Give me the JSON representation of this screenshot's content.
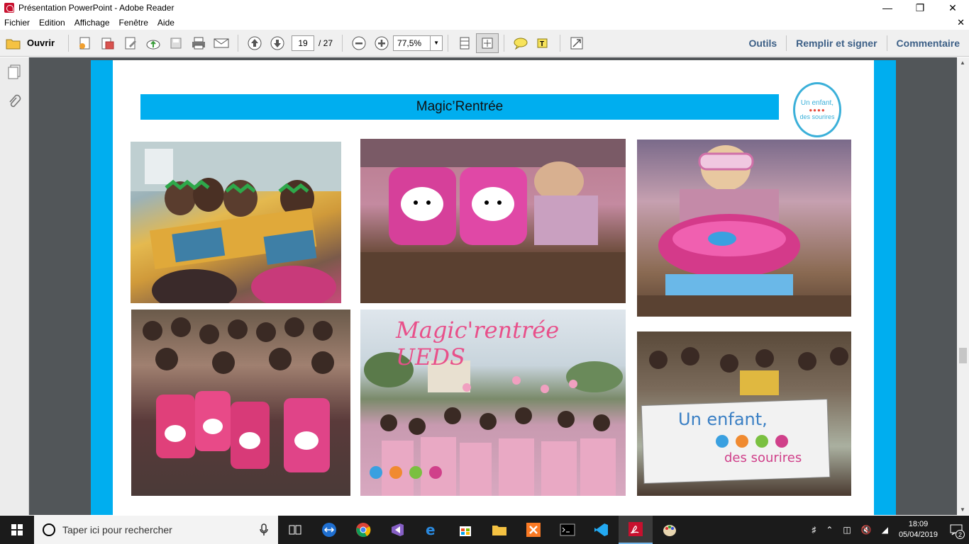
{
  "window": {
    "title": "Présentation PowerPoint - Adobe Reader"
  },
  "menu": {
    "items": [
      "Fichier",
      "Edition",
      "Affichage",
      "Fenêtre",
      "Aide"
    ]
  },
  "toolbar": {
    "open_label": "Ouvrir",
    "page_current": "19",
    "page_total": "/ 27",
    "zoom": "77,5%",
    "right_links": [
      "Outils",
      "Remplir et signer",
      "Commentaire"
    ]
  },
  "slide": {
    "banner_title": "Magic’Rentrée",
    "logo_text_top": "Un enfant,",
    "logo_text_bottom": "des sourires",
    "photo_caption_center": "Magic'rentrée UEDS",
    "photo_banner_top": "Un enfant,",
    "photo_banner_bottom": "des sourires"
  },
  "taskbar": {
    "search_placeholder": "Taper ici pour rechercher",
    "time": "18:09",
    "date": "05/04/2019",
    "notification_count": "2"
  },
  "colors": {
    "accent": "#00aeef",
    "taskbar": "#1b1b1b",
    "doc_bg": "#525659",
    "link": "#3c5f86"
  }
}
